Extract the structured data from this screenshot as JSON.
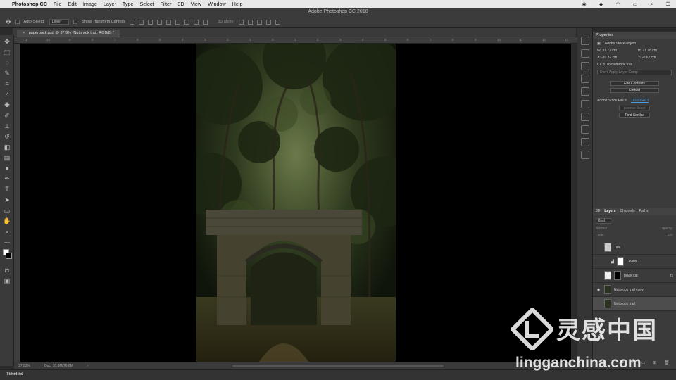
{
  "menubar": {
    "app": "Photoshop CC",
    "items": [
      "File",
      "Edit",
      "Image",
      "Layer",
      "Type",
      "Select",
      "Filter",
      "3D",
      "View",
      "Window",
      "Help"
    ]
  },
  "window_title": "Adobe Photoshop CC 2018",
  "options": {
    "auto_select_label": "Auto-Select:",
    "auto_select_value": "Layer",
    "transform_label": "Show Transform Controls",
    "mode_3d": "3D Mode:"
  },
  "document_tab": "paperback.psd @ 37.9% (Nutbrook trail, RGB/8) *",
  "ruler_ticks": [
    "11",
    "10",
    "9",
    "8",
    "7",
    "6",
    "5",
    "4",
    "3",
    "2",
    "1",
    "0",
    "1",
    "2",
    "3",
    "4",
    "5",
    "6",
    "7",
    "8",
    "9",
    "10",
    "11",
    "12",
    "13",
    "14"
  ],
  "status": {
    "zoom": "37.92%",
    "doc": "Doc: 10.3M/76.6M"
  },
  "timeline_label": "Timeline",
  "properties": {
    "title": "Properties",
    "object_type": "Adobe Stock Object",
    "w": "W: 31.72 cm",
    "h": "H: 21.18 cm",
    "x": "X: -10.32 cm",
    "y": "Y: -0.62 cm",
    "library": "CL 2018/Nutbrook trail",
    "layer_comp": "Don't Apply Layer Comp",
    "edit_btn": "Edit Contents",
    "embed_btn": "Embed",
    "stock_file_label": "Adobe Stock File #",
    "stock_file_id": "101236463",
    "license_btn": "License Asset",
    "find_btn": "Find Similar"
  },
  "layers_panel": {
    "tabs": [
      "3D",
      "Layers",
      "Channels",
      "Paths"
    ],
    "kind": "Kind",
    "blend": "Normal",
    "opacity": "Opacity:",
    "lock": "Lock:",
    "fill": "Fill:",
    "rows": [
      "Title",
      "Levels 1",
      "black cat",
      "Nutbrook trail copy",
      "Nutbrook trail"
    ]
  },
  "watermark": {
    "brand": "灵感中国",
    "url": "lingganchina.com"
  },
  "colors": {
    "canvas_bg": "#000000",
    "panel_bg": "#3b3b3b",
    "accent_link": "#4a9be0"
  }
}
